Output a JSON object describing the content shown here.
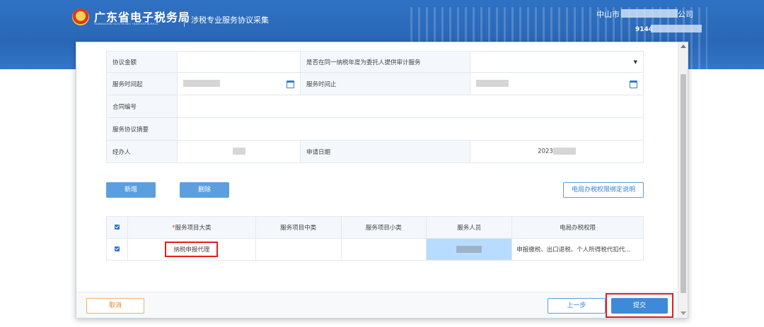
{
  "header": {
    "brand_title": "广东省电子税务局",
    "brand_subtitle": "GUANGDONG ELECTRONIC TAXATION BUREAU",
    "page_title": "涉税专业服务协议采集",
    "company_prefix": "中山市",
    "company_suffix": "公司",
    "tax_id_prefix": "9144"
  },
  "form": {
    "amount_label": "协议金额",
    "amount_value": "",
    "audit_label": "是否在同一纳税年度为委托人提供审计服务",
    "audit_value": "",
    "start_label": "服务时间起",
    "end_label": "服务时间止",
    "contract_label": "合同编号",
    "contract_value": "",
    "summary_label": "服务协议摘要",
    "summary_value": "",
    "handler_label": "经办人",
    "apply_date_label": "申请日期",
    "apply_date_prefix": "2023"
  },
  "actions": {
    "add_label": "新增",
    "delete_label": "删除",
    "help_label": "电局办税权限绑定说明"
  },
  "grid": {
    "headers": {
      "required_mark": "*",
      "category": "服务项目大类",
      "middle": "服务项目中类",
      "small": "服务项目小类",
      "staff": "服务人员",
      "permission": "电局办税权限"
    },
    "rows": [
      {
        "category": "纳税申报代理",
        "middle": "",
        "small": "",
        "permission": "申报缴税、出口退税、个人所得税代扣代..."
      }
    ]
  },
  "footer": {
    "cancel_label": "取消",
    "prev_label": "上一步",
    "submit_label": "提交"
  },
  "colors": {
    "header_blue": "#2f72c3",
    "button_blue": "#5b9fe0",
    "highlight_red": "#e21f1f",
    "cancel_orange": "#e08a30",
    "staff_cell_blue": "#b8dcff"
  },
  "icons": {
    "logo": "tax-bureau-emblem",
    "date_picker": "calendar-icon",
    "select": "caret-down-icon",
    "checkbox": "checkbox-checked-icon"
  }
}
